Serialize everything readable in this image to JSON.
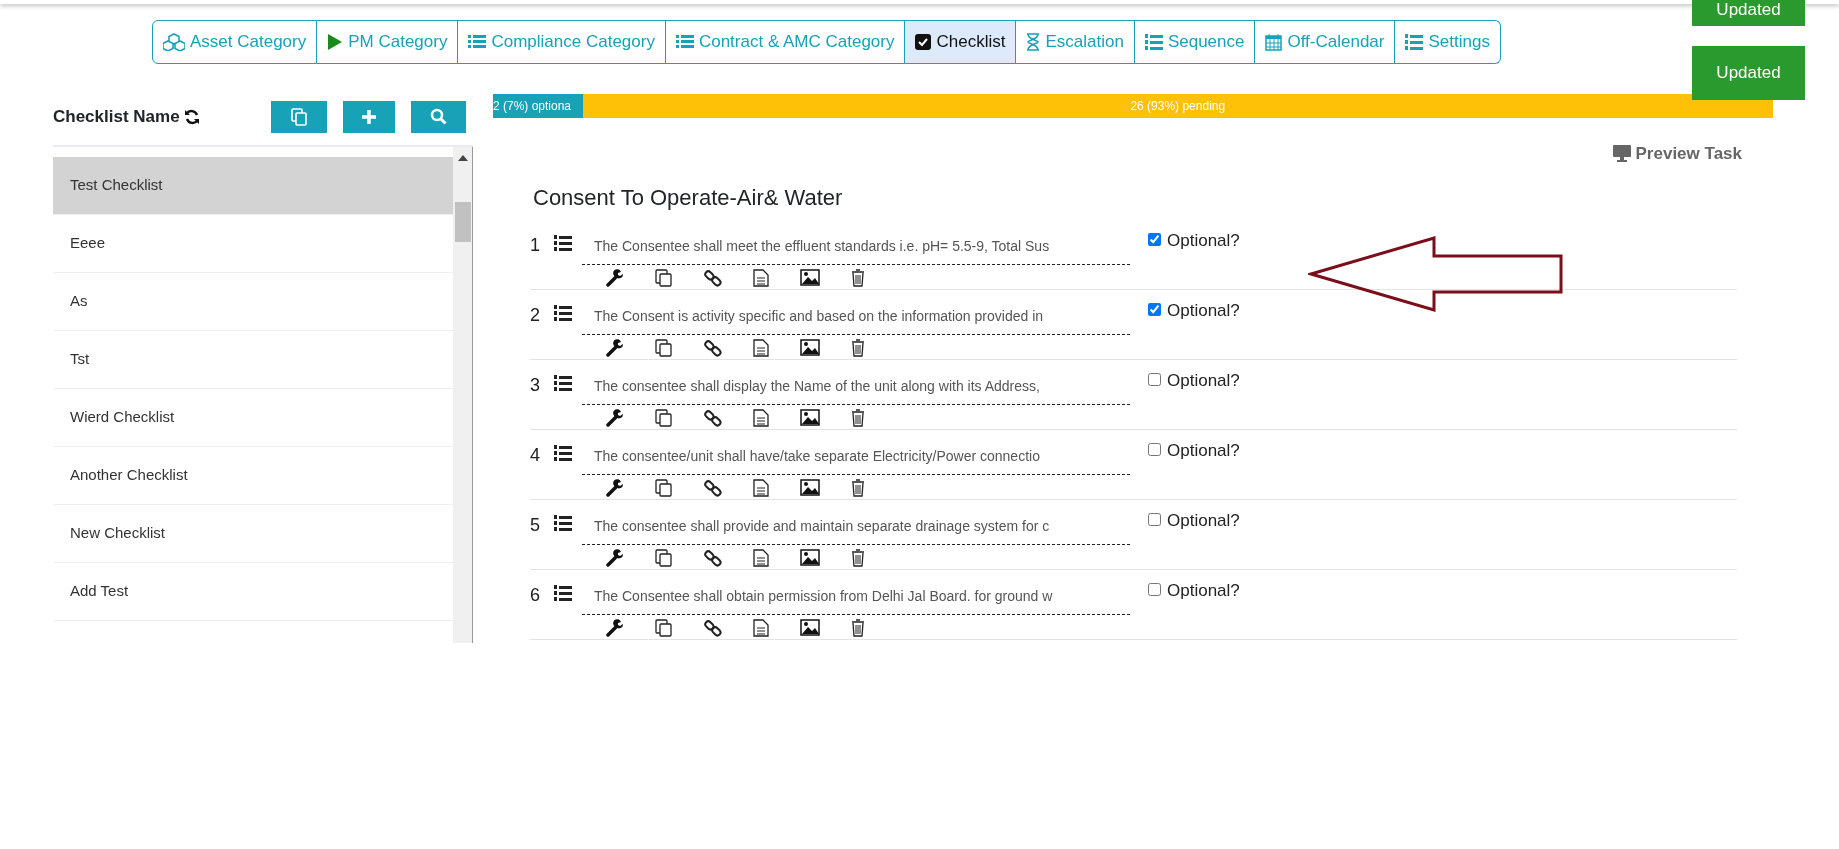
{
  "tabs": [
    {
      "label": "Asset Category",
      "selected": false
    },
    {
      "label": "PM Category",
      "selected": false
    },
    {
      "label": "Compliance Category",
      "selected": false
    },
    {
      "label": "Contract & AMC Category",
      "selected": false
    },
    {
      "label": "Checklist",
      "selected": true
    },
    {
      "label": "Escalation",
      "selected": false
    },
    {
      "label": "Sequence",
      "selected": false
    },
    {
      "label": "Off-Calendar",
      "selected": false
    },
    {
      "label": "Settings",
      "selected": false
    }
  ],
  "toasts": [
    "Updated",
    "Updated"
  ],
  "sidebar": {
    "title": "Checklist Name",
    "items": [
      {
        "label": "Test Checklist",
        "selected": true
      },
      {
        "label": "Eeee",
        "selected": false
      },
      {
        "label": "As",
        "selected": false
      },
      {
        "label": "Tst",
        "selected": false
      },
      {
        "label": "Wierd Checklist",
        "selected": false
      },
      {
        "label": "Another Checklist",
        "selected": false
      },
      {
        "label": "New Checklist",
        "selected": false
      },
      {
        "label": "Add Test",
        "selected": false
      }
    ]
  },
  "progress": [
    {
      "label": "2 (7%) optiona",
      "level": 0.07,
      "kind": "optional"
    },
    {
      "label": "26 (93%) pending",
      "level": 0.93,
      "kind": "pending"
    }
  ],
  "preview_label": "Preview Task",
  "section_title": "Consent To Operate-Air& Water",
  "items": [
    {
      "number": "1",
      "text": "The Consentee shall meet the effluent standards i.e. pH= 5.5-9, Total Sus",
      "optional_label": "Optional?",
      "checked": true
    },
    {
      "number": "2",
      "text": "The Consent is activity specific and based on the information provided in",
      "optional_label": "Optional?",
      "checked": true
    },
    {
      "number": "3",
      "text": "The consentee shall display the Name of the unit along with its Address,",
      "optional_label": "Optional?",
      "checked": false
    },
    {
      "number": "4",
      "text": "The consentee/unit shall have/take separate Electricity/Power connectio",
      "optional_label": "Optional?",
      "checked": false
    },
    {
      "number": "5",
      "text": "The consentee shall provide and maintain separate drainage system for c",
      "optional_label": "Optional?",
      "checked": false
    },
    {
      "number": "6",
      "text": "The Consentee shall obtain permission from Delhi Jal Board. for ground w",
      "optional_label": "Optional?",
      "checked": false
    }
  ]
}
